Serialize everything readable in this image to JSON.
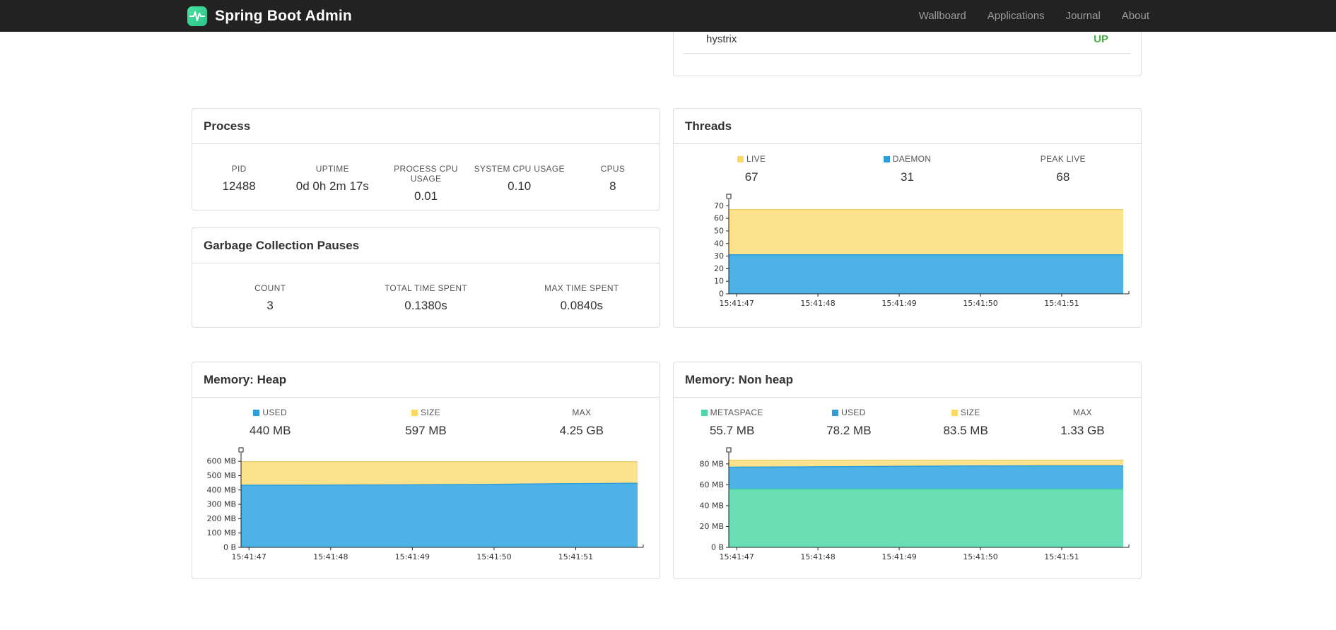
{
  "navbar": {
    "brand": "Spring Boot Admin",
    "links": [
      {
        "label": "Wallboard"
      },
      {
        "label": "Applications"
      },
      {
        "label": "Journal"
      },
      {
        "label": "About"
      }
    ]
  },
  "status_panel": {
    "row_label": "hystrix",
    "row_status": "UP",
    "status_color": "#43b143"
  },
  "process": {
    "title": "Process",
    "stats": [
      {
        "label": "PID",
        "value": "12488"
      },
      {
        "label": "UPTIME",
        "value": "0d 0h 2m 17s"
      },
      {
        "label": "PROCESS CPU USAGE",
        "value": "0.01"
      },
      {
        "label": "SYSTEM CPU USAGE",
        "value": "0.10"
      },
      {
        "label": "CPUS",
        "value": "8"
      }
    ]
  },
  "gc": {
    "title": "Garbage Collection Pauses",
    "stats": [
      {
        "label": "COUNT",
        "value": "3"
      },
      {
        "label": "TOTAL TIME SPENT",
        "value": "0.1380s"
      },
      {
        "label": "MAX TIME SPENT",
        "value": "0.0840s"
      }
    ]
  },
  "chart_data": {
    "threads": {
      "type": "area",
      "title": "Threads",
      "xlabel": "",
      "ylabel": "",
      "x_labels": [
        "15:41:47",
        "15:41:48",
        "15:41:49",
        "15:41:50",
        "15:41:51"
      ],
      "y_ticks": [
        {
          "v": 0,
          "label": "0"
        },
        {
          "v": 10,
          "label": "10"
        },
        {
          "v": 20,
          "label": "20"
        },
        {
          "v": 30,
          "label": "30"
        },
        {
          "v": 40,
          "label": "40"
        },
        {
          "v": 50,
          "label": "50"
        },
        {
          "v": 60,
          "label": "60"
        },
        {
          "v": 70,
          "label": "70"
        }
      ],
      "ylim": [
        0,
        73
      ],
      "grid": false,
      "legend_position": "top",
      "legend": [
        {
          "label": "LIVE",
          "value": "67",
          "color": "#fbda63"
        },
        {
          "label": "DAEMON",
          "value": "31",
          "color": "#2d9ddb"
        },
        {
          "label": "PEAK LIVE",
          "value": "68",
          "color": null
        }
      ],
      "series": [
        {
          "name": "LIVE",
          "fill": "#fce28b",
          "stroke": "#e9cf6d",
          "values": [
            67,
            67,
            67,
            67,
            67,
            67
          ]
        },
        {
          "name": "DAEMON",
          "fill": "#4db3e6",
          "stroke": "#2d9ddb",
          "values": [
            31,
            31,
            31,
            31,
            31,
            31
          ]
        }
      ]
    },
    "memory_heap": {
      "type": "area",
      "title": "Memory: Heap",
      "xlabel": "",
      "ylabel": "",
      "x_labels": [
        "15:41:47",
        "15:41:48",
        "15:41:49",
        "15:41:50",
        "15:41:51"
      ],
      "y_ticks": [
        {
          "v": 0,
          "label": "0 B"
        },
        {
          "v": 100,
          "label": "100 MB"
        },
        {
          "v": 200,
          "label": "200 MB"
        },
        {
          "v": 300,
          "label": "300 MB"
        },
        {
          "v": 400,
          "label": "400 MB"
        },
        {
          "v": 500,
          "label": "500 MB"
        },
        {
          "v": 600,
          "label": "600 MB"
        }
      ],
      "ylim": [
        0,
        640
      ],
      "grid": false,
      "legend_position": "top",
      "legend": [
        {
          "label": "USED",
          "value": "440 MB",
          "color": "#2d9ddb"
        },
        {
          "label": "SIZE",
          "value": "597 MB",
          "color": "#fbda63"
        },
        {
          "label": "MAX",
          "value": "4.25 GB",
          "color": null
        }
      ],
      "series": [
        {
          "name": "SIZE",
          "fill": "#fce28b",
          "stroke": "#e9cf6d",
          "values": [
            597,
            597,
            597,
            597,
            597,
            597
          ]
        },
        {
          "name": "USED",
          "fill": "#4db3e6",
          "stroke": "#2d9ddb",
          "values": [
            433,
            434,
            436,
            438,
            444,
            447
          ]
        }
      ]
    },
    "memory_nonheap": {
      "type": "area",
      "title": "Memory: Non heap",
      "xlabel": "",
      "ylabel": "",
      "x_labels": [
        "15:41:47",
        "15:41:48",
        "15:41:49",
        "15:41:50",
        "15:41:51"
      ],
      "y_ticks": [
        {
          "v": 0,
          "label": "0 B"
        },
        {
          "v": 20,
          "label": "20 MB"
        },
        {
          "v": 40,
          "label": "40 MB"
        },
        {
          "v": 60,
          "label": "60 MB"
        },
        {
          "v": 80,
          "label": "80 MB"
        }
      ],
      "ylim": [
        0,
        88
      ],
      "grid": false,
      "legend_position": "top",
      "legend": [
        {
          "label": "METASPACE",
          "value": "55.7 MB",
          "color": "#4fd6a4"
        },
        {
          "label": "USED",
          "value": "78.2 MB",
          "color": "#2d9ddb"
        },
        {
          "label": "SIZE",
          "value": "83.5 MB",
          "color": "#fbda63"
        },
        {
          "label": "MAX",
          "value": "1.33 GB",
          "color": null
        }
      ],
      "series": [
        {
          "name": "SIZE",
          "fill": "#fce28b",
          "stroke": "#e9cf6d",
          "values": [
            83.5,
            83.5,
            83.5,
            83.5,
            83.5,
            83.5
          ]
        },
        {
          "name": "USED",
          "fill": "#4db3e6",
          "stroke": "#2d9ddb",
          "values": [
            76.8,
            77.2,
            77.6,
            78.0,
            78.2,
            78.2
          ]
        },
        {
          "name": "METASPACE",
          "fill": "#6adfb6",
          "stroke": "#46d3a0",
          "values": [
            55.7,
            55.7,
            55.7,
            55.7,
            55.7,
            55.7
          ]
        }
      ]
    }
  }
}
